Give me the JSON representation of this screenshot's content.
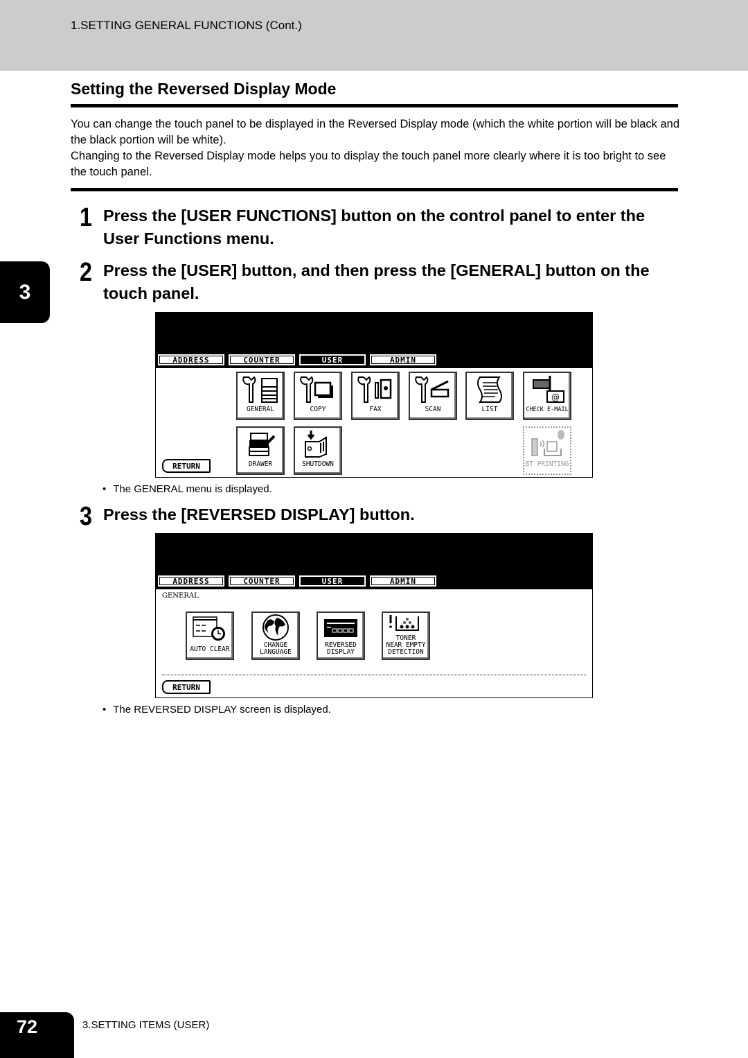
{
  "header": {
    "running_title": "1.SETTING GENERAL FUNCTIONS (Cont.)"
  },
  "section": {
    "title": "Setting the Reversed Display Mode",
    "intro": [
      "You can change the touch panel to be displayed in the Reversed Display mode (which the white portion will be black and the black portion will be white).",
      "Changing to the Reversed Display mode helps you to display the touch panel more clearly where it is too bright to see the touch panel."
    ]
  },
  "chapter_tab": "3",
  "steps": [
    {
      "num": "1",
      "text": "Press the [USER FUNCTIONS] button on the control panel to enter the User Functions menu."
    },
    {
      "num": "2",
      "text": "Press the [USER] button, and then press the [GENERAL] button on the touch panel."
    },
    {
      "num": "3",
      "text": "Press the [REVERSED DISPLAY] button."
    }
  ],
  "screen1": {
    "tabs": [
      "ADDRESS",
      "COUNTER",
      "USER",
      "ADMIN"
    ],
    "active_tab": "USER",
    "buttons_row1": [
      {
        "label": "GENERAL",
        "icon": "wrench-copier-icon"
      },
      {
        "label": "COPY",
        "icon": "wrench-copy-icon"
      },
      {
        "label": "FAX",
        "icon": "wrench-fax-icon"
      },
      {
        "label": "SCAN",
        "icon": "wrench-scan-icon"
      },
      {
        "label": "LIST",
        "icon": "list-scroll-icon"
      },
      {
        "label": "CHECK E-MAIL",
        "icon": "mailbox-icon"
      }
    ],
    "buttons_row2": [
      {
        "label": "DRAWER",
        "icon": "copier-drawer-icon"
      },
      {
        "label": "SHUTDOWN",
        "icon": "power-switch-icon"
      }
    ],
    "disabled_button": {
      "label": "BT PRINTING",
      "icon": "bluetooth-printing-icon"
    },
    "return_label": "RETURN",
    "note": "The GENERAL menu is displayed."
  },
  "screen2": {
    "tabs": [
      "ADDRESS",
      "COUNTER",
      "USER",
      "ADMIN"
    ],
    "active_tab": "USER",
    "screen_label": "GENERAL",
    "buttons": [
      {
        "label": "AUTO CLEAR",
        "icon": "timer-icon"
      },
      {
        "label": "CHANGE\nLANGUAGE",
        "icon": "globe-icon"
      },
      {
        "label": "REVERSED\nDISPLAY",
        "icon": "display-panel-icon"
      },
      {
        "label": "TONER\nNEAR EMPTY\nDETECTION",
        "icon": "toner-icon"
      }
    ],
    "return_label": "RETURN",
    "note": "The REVERSED DISPLAY screen is displayed."
  },
  "footer": {
    "page_number": "72",
    "section": "3.SETTING ITEMS (USER)"
  }
}
